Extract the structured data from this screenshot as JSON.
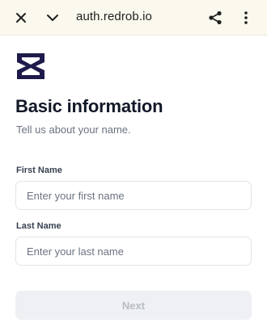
{
  "browser": {
    "url": "auth.redrob.io",
    "icons": {
      "close": "close-icon",
      "collapse": "chevron-down-icon",
      "share": "share-icon",
      "menu": "more-vert-icon"
    }
  },
  "logo": {
    "icon": "redrob-logo",
    "color": "#1e1b4b"
  },
  "page": {
    "title": "Basic information",
    "subtitle": "Tell us about your name."
  },
  "form": {
    "first_name": {
      "label": "First Name",
      "value": "",
      "placeholder": "Enter your first name"
    },
    "last_name": {
      "label": "Last Name",
      "value": "",
      "placeholder": "Enter your last name"
    },
    "next_label": "Next",
    "next_disabled": true
  },
  "colors": {
    "browser_bar": "#fbf8ee",
    "title": "#111827",
    "muted_text": "#6b7280",
    "button_disabled_bg": "#eef0f3",
    "button_disabled_text": "#b7bcc4"
  }
}
